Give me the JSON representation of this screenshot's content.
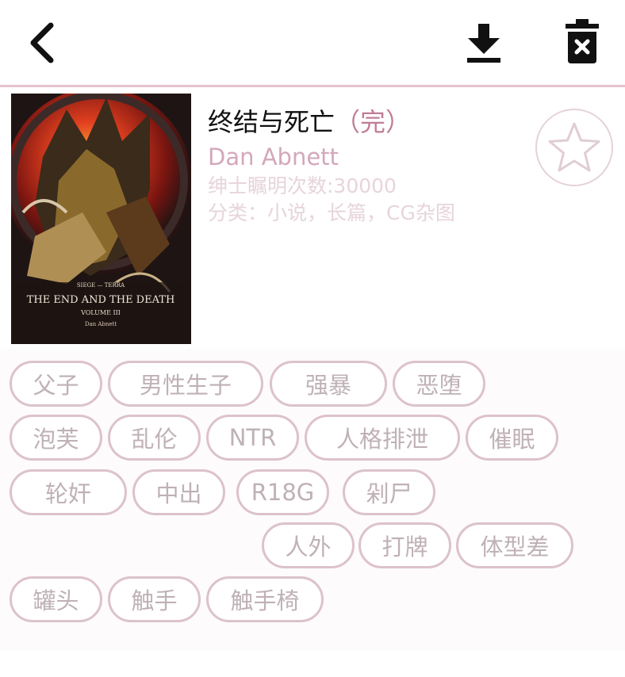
{
  "header": {
    "back_icon": "chevron-left-icon",
    "download_icon": "download-icon",
    "delete_icon": "trash-icon"
  },
  "book": {
    "title": "终结与死亡",
    "status": "（完）",
    "author": "Dan Abnett",
    "views": "绅士瞩明次数:30000",
    "category": "分类：小说，长篇，CG杂图",
    "cover": {
      "series": "SIEGE — TERRA",
      "title": "THE END AND THE DEATH",
      "volume": "VOLUME III",
      "author": "Dan Abnett"
    }
  },
  "favorite_icon": "star-outline-icon",
  "tags": [
    "父子",
    "男性生子",
    "强暴",
    "恶堕",
    "泡芙",
    "乱伦",
    "NTR",
    "人格排泄",
    "催眠",
    "轮奸",
    "中出",
    "R18G",
    "剁尸",
    "人外",
    "打牌",
    "体型差",
    "罐头",
    "触手",
    "触手椅"
  ],
  "colors": {
    "accent": "#c07d97",
    "divider": "#e6c2cf",
    "tag_border": "#dcc2cc",
    "tag_text": "#bfb1b6"
  }
}
